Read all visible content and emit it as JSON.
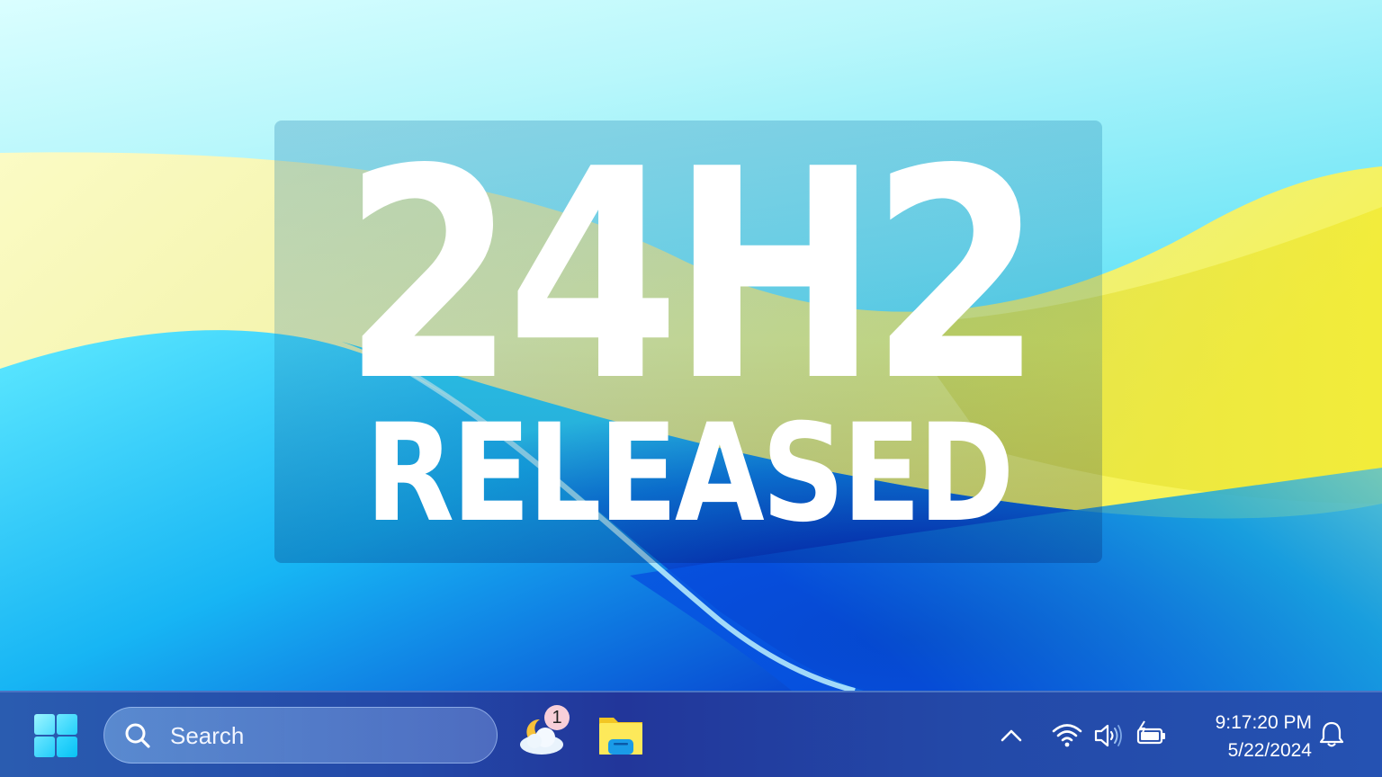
{
  "overlay": {
    "title_line1": "24H2",
    "title_line2": "RELEASED"
  },
  "taskbar": {
    "start_icon": "windows-logo-icon",
    "search": {
      "icon": "search-icon",
      "placeholder": "Search"
    },
    "pinned": [
      {
        "name": "weather",
        "icon": "weather-moon-cloud-icon",
        "badge": "1"
      },
      {
        "name": "file-explorer",
        "icon": "folder-icon"
      }
    ],
    "tray": {
      "show_hidden_icon": "chevron-up-icon",
      "wifi_icon": "wifi-icon",
      "volume_icon": "speaker-icon",
      "battery_icon": "battery-charging-icon",
      "time": "9:17:20 PM",
      "date": "5/22/2024",
      "notification_icon": "bell-icon"
    }
  },
  "colors": {
    "taskbar": "#2348a8",
    "accent_cyan": "#24d0fb",
    "wallpaper_yellow": "#f3f07a",
    "wallpaper_blue": "#0a4ad6",
    "headline": "#ffffff"
  }
}
